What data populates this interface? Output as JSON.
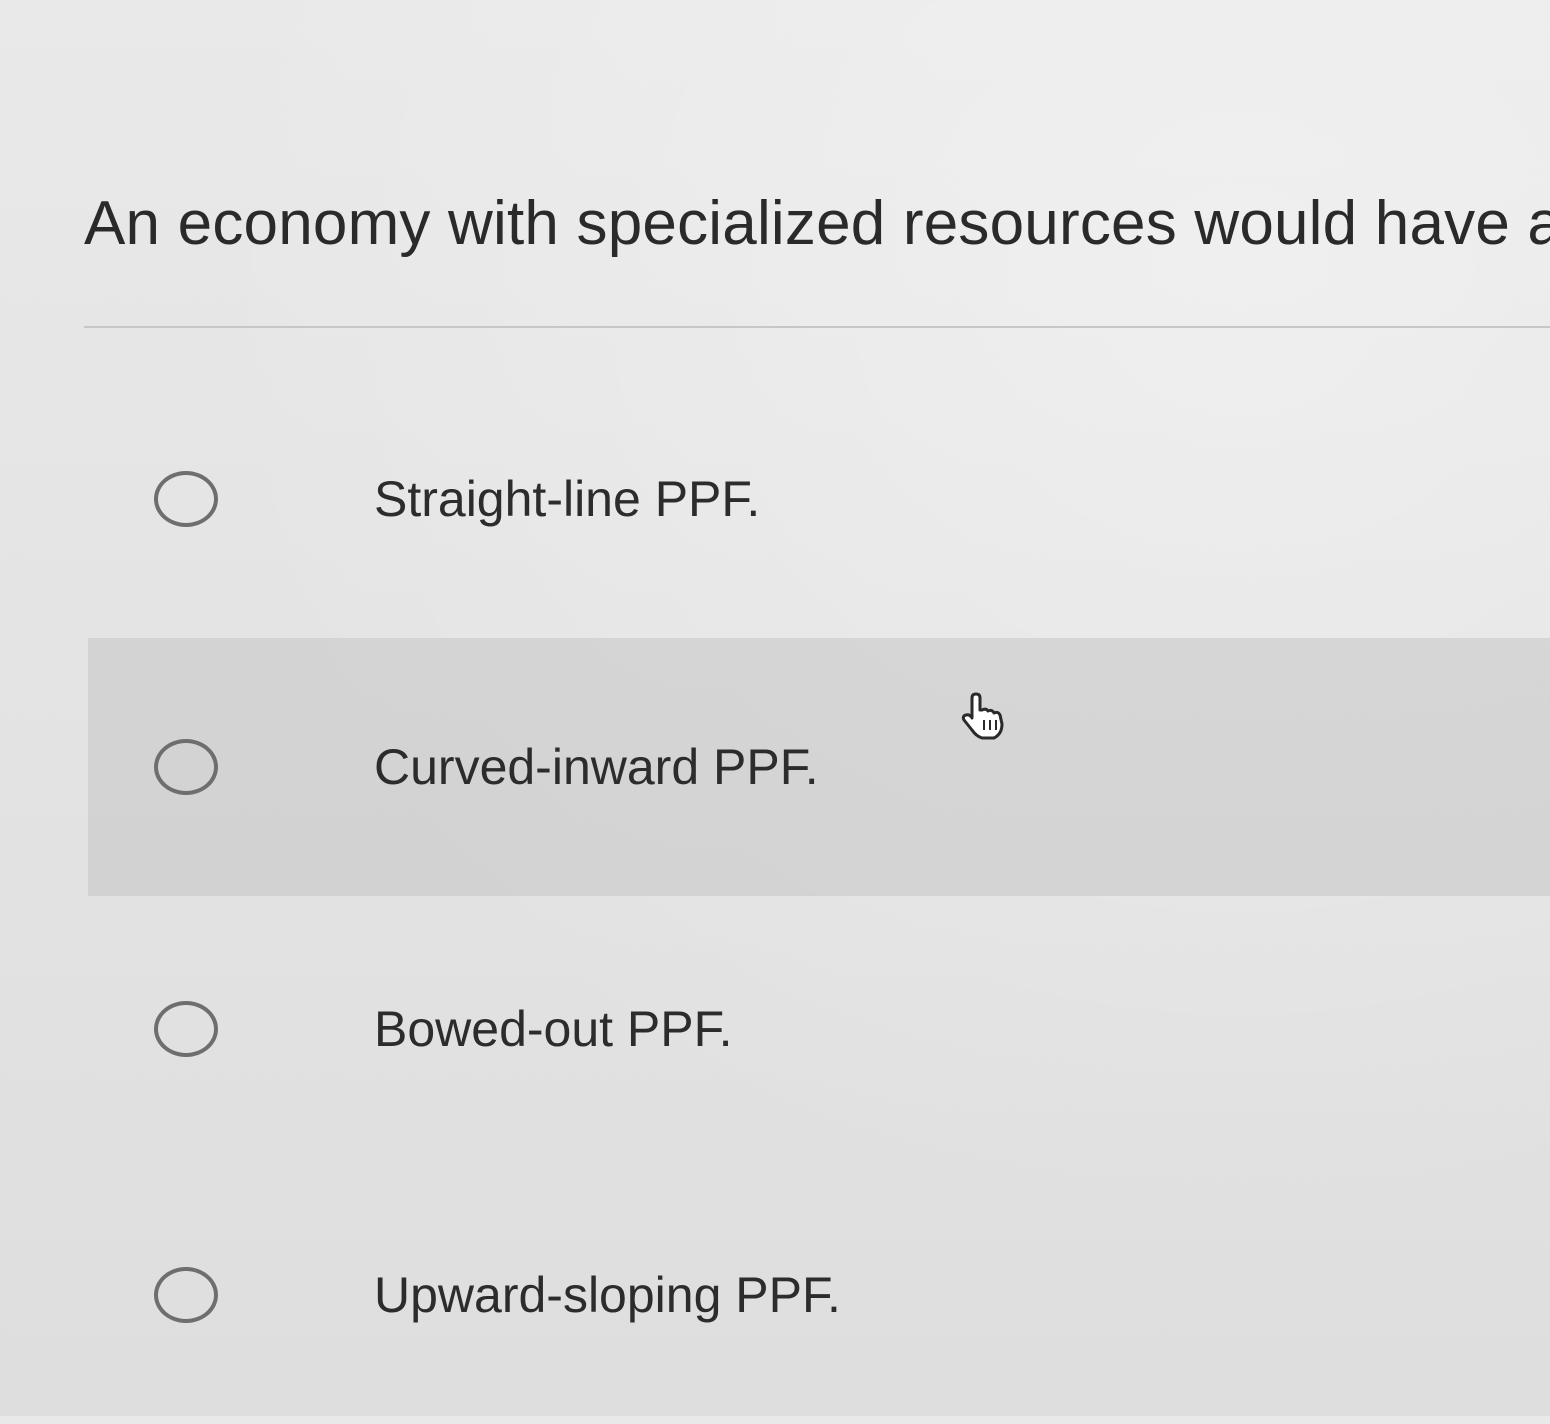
{
  "question": {
    "text": "An economy with specialized resources would have a"
  },
  "options": [
    {
      "label": "Straight-line PPF.",
      "selected": false
    },
    {
      "label": "Curved-inward PPF.",
      "selected": false
    },
    {
      "label": "Bowed-out PPF.",
      "selected": false
    },
    {
      "label": "Upward-sloping PPF.",
      "selected": false
    }
  ],
  "cursor": {
    "icon": "hand-pointer-icon"
  },
  "colors": {
    "background": "#e6e6e6",
    "hover_row": "#d8d8d8",
    "radio_border": "#6e6e6e",
    "text": "#2c2c2c"
  }
}
